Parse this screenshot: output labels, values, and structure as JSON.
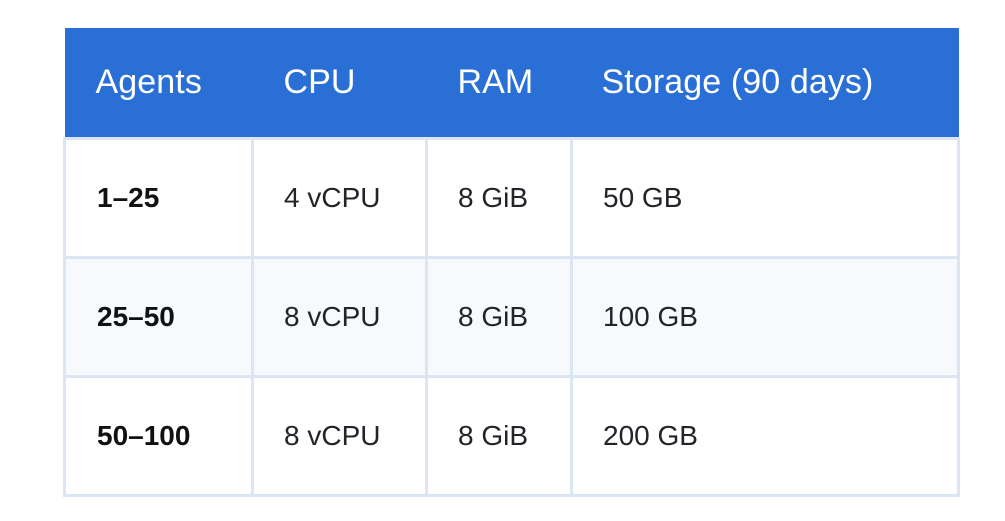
{
  "table": {
    "name": "agent-sizing-requirements",
    "header_background": "#2a6fd6",
    "header_text_color": "#ffffff",
    "border_color": "#dbe5f4",
    "alt_row_background": "#f8f9fd",
    "columns": [
      {
        "key": "agents",
        "label": "Agents"
      },
      {
        "key": "cpu",
        "label": "CPU"
      },
      {
        "key": "ram",
        "label": "RAM"
      },
      {
        "key": "storage",
        "label": "Storage (90 days)"
      }
    ],
    "rows": [
      {
        "agents": "1–25",
        "cpu": "4 vCPU",
        "ram": "8 GiB",
        "storage": "50 GB"
      },
      {
        "agents": "25–50",
        "cpu": "8 vCPU",
        "ram": "8 GiB",
        "storage": "100 GB"
      },
      {
        "agents": "50–100",
        "cpu": "8 vCPU",
        "ram": "8 GiB",
        "storage": "200 GB"
      }
    ]
  }
}
